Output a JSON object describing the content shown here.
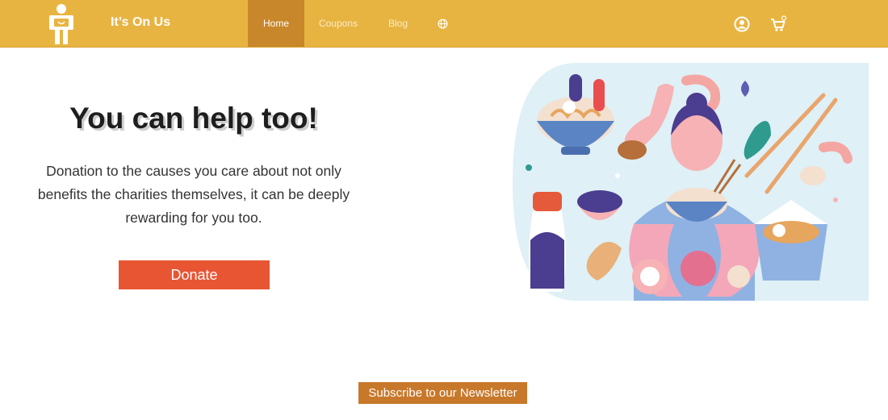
{
  "header": {
    "brand": "It’s On Us",
    "nav": {
      "home": "Home",
      "coupons": "Coupons",
      "blog": "Blog"
    },
    "icons": {
      "logo": "person-holding-box-logo",
      "language": "globe-icon",
      "account": "user-circle-icon",
      "cart": "shopping-cart-icon"
    }
  },
  "hero": {
    "title": "You can help too!",
    "body": "Donation to the causes you care about not only benefits the charities themselves, it can be deeply rewarding for you too.",
    "donate_label": "Donate",
    "illustration": "woman-eating-ramen-illustration"
  },
  "footer": {
    "newsletter_label": "Subscribe to our Newsletter"
  },
  "colors": {
    "header_bg": "#e8b441",
    "active_tab_bg": "#c8872a",
    "donate_bg": "#e85533",
    "newsletter_bg": "#c8782a",
    "illustration_bg": "#dff0f6"
  }
}
